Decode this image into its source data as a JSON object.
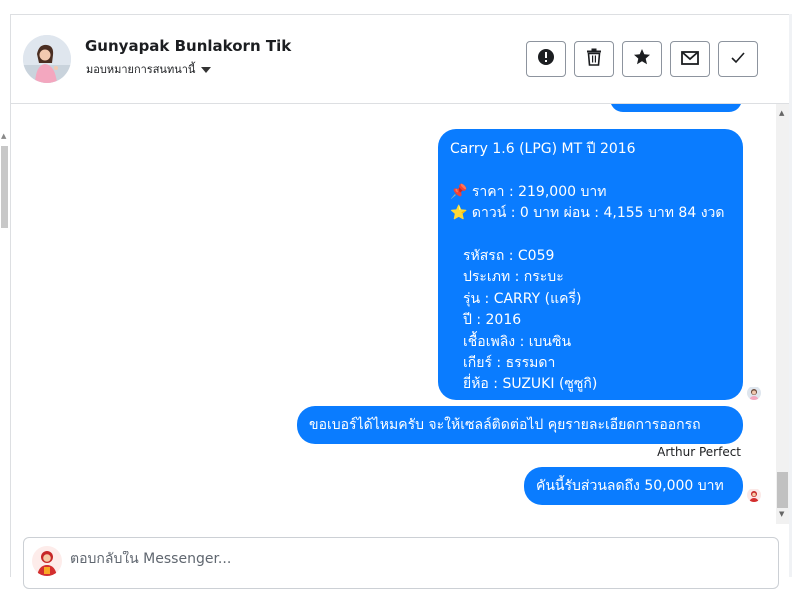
{
  "conversation": {
    "contact_name": "Gunyapak Bunlakorn Tik",
    "assign_label": "มอบหมายการสนทนานี้",
    "actions": [
      {
        "icon": "exclamation-circle-icon"
      },
      {
        "icon": "trash-icon"
      },
      {
        "icon": "star-icon"
      },
      {
        "icon": "envelope-icon"
      },
      {
        "icon": "checkmark-icon"
      }
    ]
  },
  "messages": {
    "car_listing": {
      "title": "Carry 1.6 (LPG) MT ปี 2016",
      "price_icon": "📌",
      "price": "ราคา : 219,000 บาท",
      "down_icon": "⭐",
      "down": "ดาวน์ : 0 บาท ผ่อน : 4,155 บาท 84 งวด",
      "car_code": "รหัสรถ : C059",
      "car_type": "ประเภท : กระบะ",
      "model": "รุ่น : CARRY (แครี่)",
      "year": "ปี : 2016",
      "fuel": "เชื้อเพลิง : เบนซิน",
      "gear": "เกียร์ : ธรรมดา",
      "brand": "ยี่ห้อ : SUZUKI (ซูซูกิ)"
    },
    "phone_request": "ขอเบอร์ได้ไหมครับ จะให้เซลล์ติดต่อไป คุยรายละเอียดการออกรถ",
    "sender_name": "Arthur Perfect",
    "discount": "คันนี้รับส่วนลดถึง 50,000 บาท"
  },
  "composer": {
    "placeholder": "ตอบกลับใน Messenger..."
  },
  "colors": {
    "bubble": "#0a7cff",
    "border": "#dddfe2"
  }
}
